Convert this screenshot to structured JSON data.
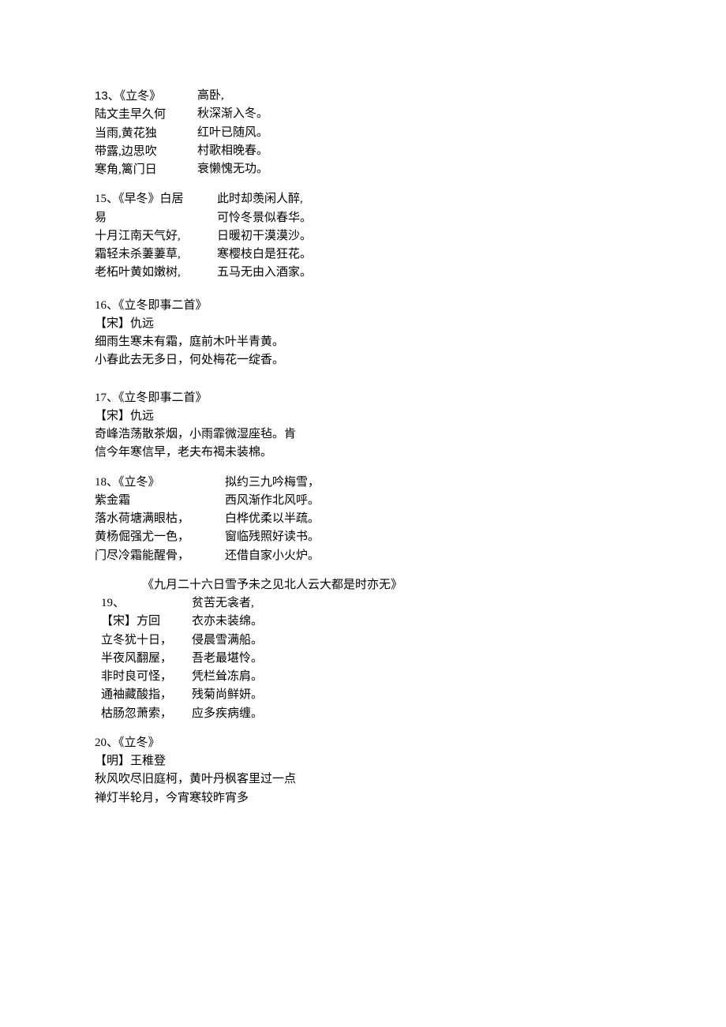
{
  "poem13": {
    "head": "13、《立冬》",
    "left": [
      "陆文圭早久何",
      "当雨,黄花独",
      "带露,边思吹",
      "寒角,篱门日"
    ],
    "right": [
      "高卧,",
      "秋深渐入冬。",
      "红叶已随风。",
      "村歌相晚春。",
      "衰懒愧无功。"
    ]
  },
  "poem15": {
    "left": [
      "15、《早冬》白居",
      "易",
      "十月江南天气好,",
      "霜轻未杀萋萋草,",
      "老柘叶黄如嫩树,"
    ],
    "right": [
      "此时却羡闲人醉,",
      "可怜冬景似春华。",
      "日暖初干漠漠沙。",
      "寒樱枝白是狂花。",
      "五马无由入酒家。"
    ]
  },
  "poem16": {
    "head": "16、《立冬即事二首》",
    "author": "【宋】仇远",
    "lines": [
      "细雨生寒未有霜，庭前木叶半青黄。",
      "小春此去无多日，何处梅花一绽香。"
    ]
  },
  "poem17": {
    "head": "17、《立冬即事二首》",
    "author": "【宋】仇远",
    "lines": [
      "奇峰浩荡散茶烟，小雨霏微湿座毡。肯",
      "信今年寒信早，老夫布褐未装棉。"
    ]
  },
  "poem18": {
    "left": [
      "18、《立冬》",
      "紫金霜",
      "落水荷塘满眼枯，",
      "黄杨倔强尤一色，",
      "门尽冷霜能醒骨，"
    ],
    "right": [
      "拟约三九吟梅雪，",
      "西风渐作北风呼。",
      "白桦优柔以半疏。",
      "窗临残照好读书。",
      "还借自家小火炉。"
    ]
  },
  "poem19": {
    "title": "《九月二十六日雪予未之见北人云大都是时亦无》",
    "left": [
      "19、",
      "【宋】方回",
      "立冬犹十日，",
      "半夜风翻屋，",
      "非时良可怪，",
      "通袖藏酸指，",
      "枯肠忽萧索，"
    ],
    "right": [
      "贫苦无衾者,",
      "衣亦未装绵。",
      "侵晨雪满船。",
      "吾老最堪怜。",
      "凭栏耸冻肩。",
      "残菊尚鲜妍。",
      "应多疾病缠。"
    ]
  },
  "poem20": {
    "head": "20、《立冬》",
    "author": "【明】王稚登",
    "lines": [
      "秋风吹尽旧庭柯，黄叶丹枫客里过一点",
      "禅灯半轮月，今宵寒较昨宵多"
    ]
  }
}
